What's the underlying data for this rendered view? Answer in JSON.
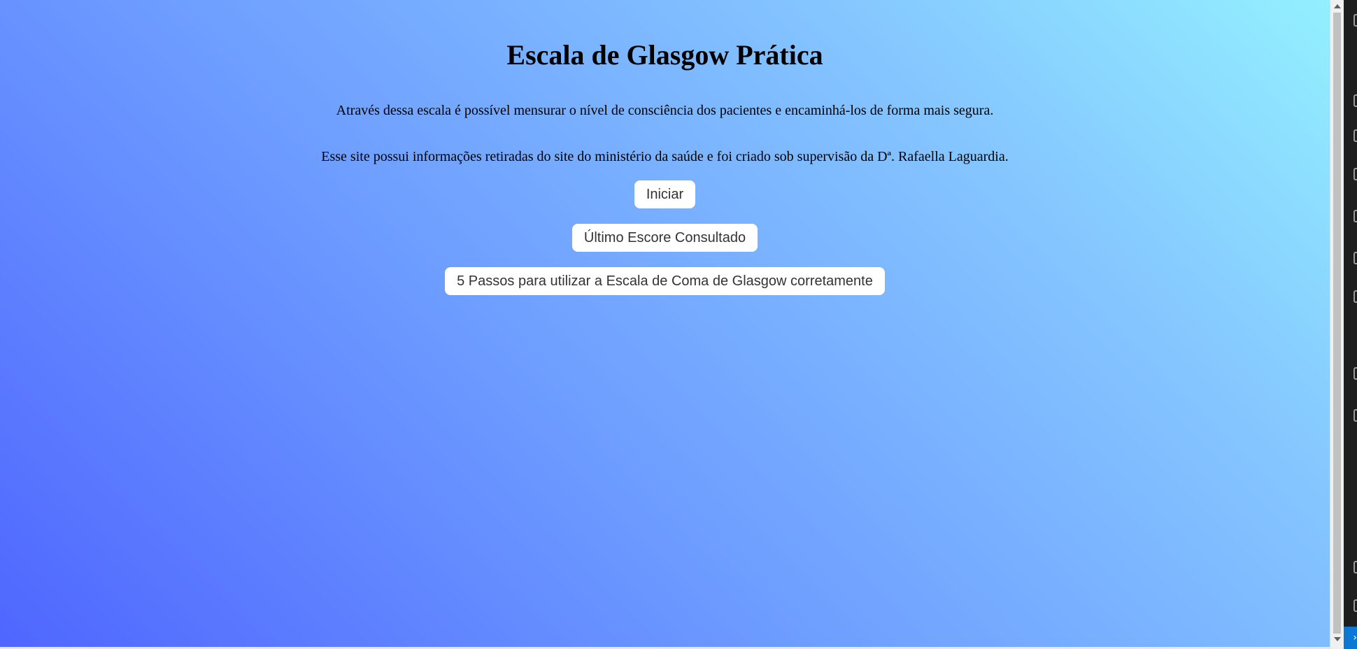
{
  "page": {
    "title": "Escala de Glasgow Prática",
    "intro": "Através dessa escala é possível mensurar o nível de consciência dos pacientes e encaminhá-los de forma mais segura.",
    "credits": "Esse site possui informações retiradas do site do ministério da saúde e foi criado sob supervisão da Dª. Rafaella Laguardia."
  },
  "buttons": {
    "start": "Iniciar",
    "last_score": "Último Escore Consultado",
    "five_steps": "5 Passos para utilizar a Escala de Coma de Glasgow corretamente"
  },
  "colors": {
    "gradient_start": "#4f66ff",
    "gradient_end": "#93f0ff",
    "button_bg": "#ffffff"
  },
  "side_panel": {
    "icons": [
      "gear-icon",
      "files-icon",
      "page-icon",
      "copy-icon",
      "account-icon",
      "extension-icon",
      "search-icon",
      "device-icon",
      "settings-icon",
      "info-icon",
      "plugin-icon"
    ],
    "badge_symbol": "›"
  }
}
